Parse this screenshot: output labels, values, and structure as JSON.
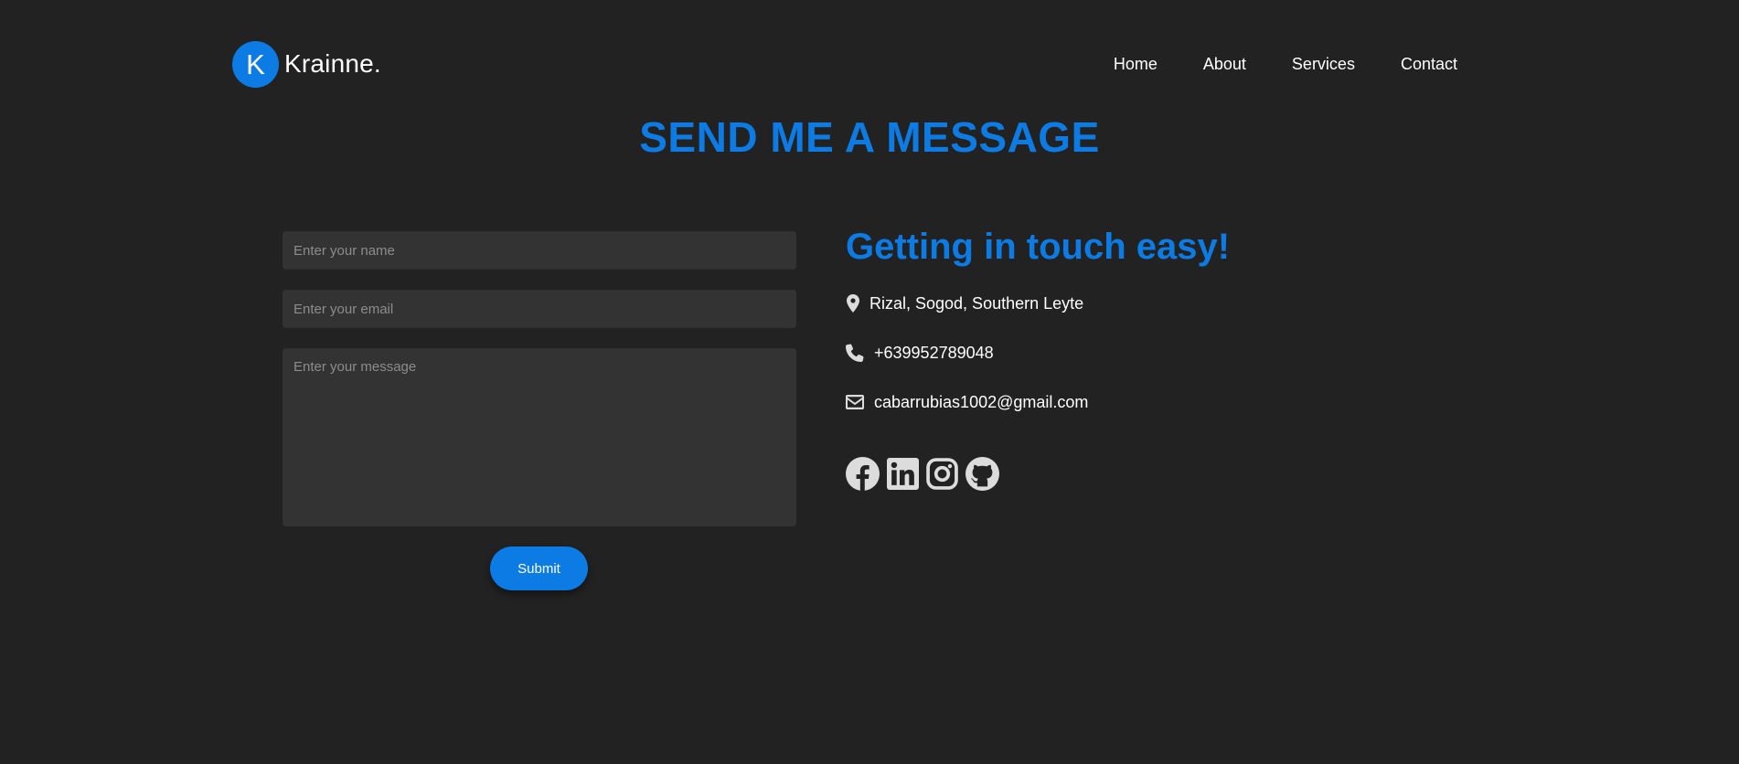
{
  "brand": {
    "letter": "K",
    "name": "Krainne."
  },
  "nav": {
    "items": [
      {
        "label": "Home"
      },
      {
        "label": "About"
      },
      {
        "label": "Services"
      },
      {
        "label": "Contact"
      }
    ]
  },
  "page": {
    "title": "SEND ME A MESSAGE"
  },
  "form": {
    "name_placeholder": "Enter your name",
    "email_placeholder": "Enter your email",
    "message_placeholder": "Enter your message",
    "submit_label": "Submit"
  },
  "contact": {
    "title": "Getting in touch easy!",
    "location": "Rizal, Sogod, Southern Leyte",
    "phone": "+639952789048",
    "email": "cabarrubias1002@gmail.com",
    "location_icon": "map-marker-icon",
    "phone_icon": "phone-icon",
    "email_icon": "envelope-icon"
  },
  "socials": [
    {
      "icon": "facebook-icon"
    },
    {
      "icon": "linkedin-icon"
    },
    {
      "icon": "instagram-icon"
    },
    {
      "icon": "github-icon"
    }
  ],
  "colors": {
    "accent": "#0d7be4",
    "background": "#222222",
    "field": "#333333",
    "icon": "#dcdcdc"
  }
}
